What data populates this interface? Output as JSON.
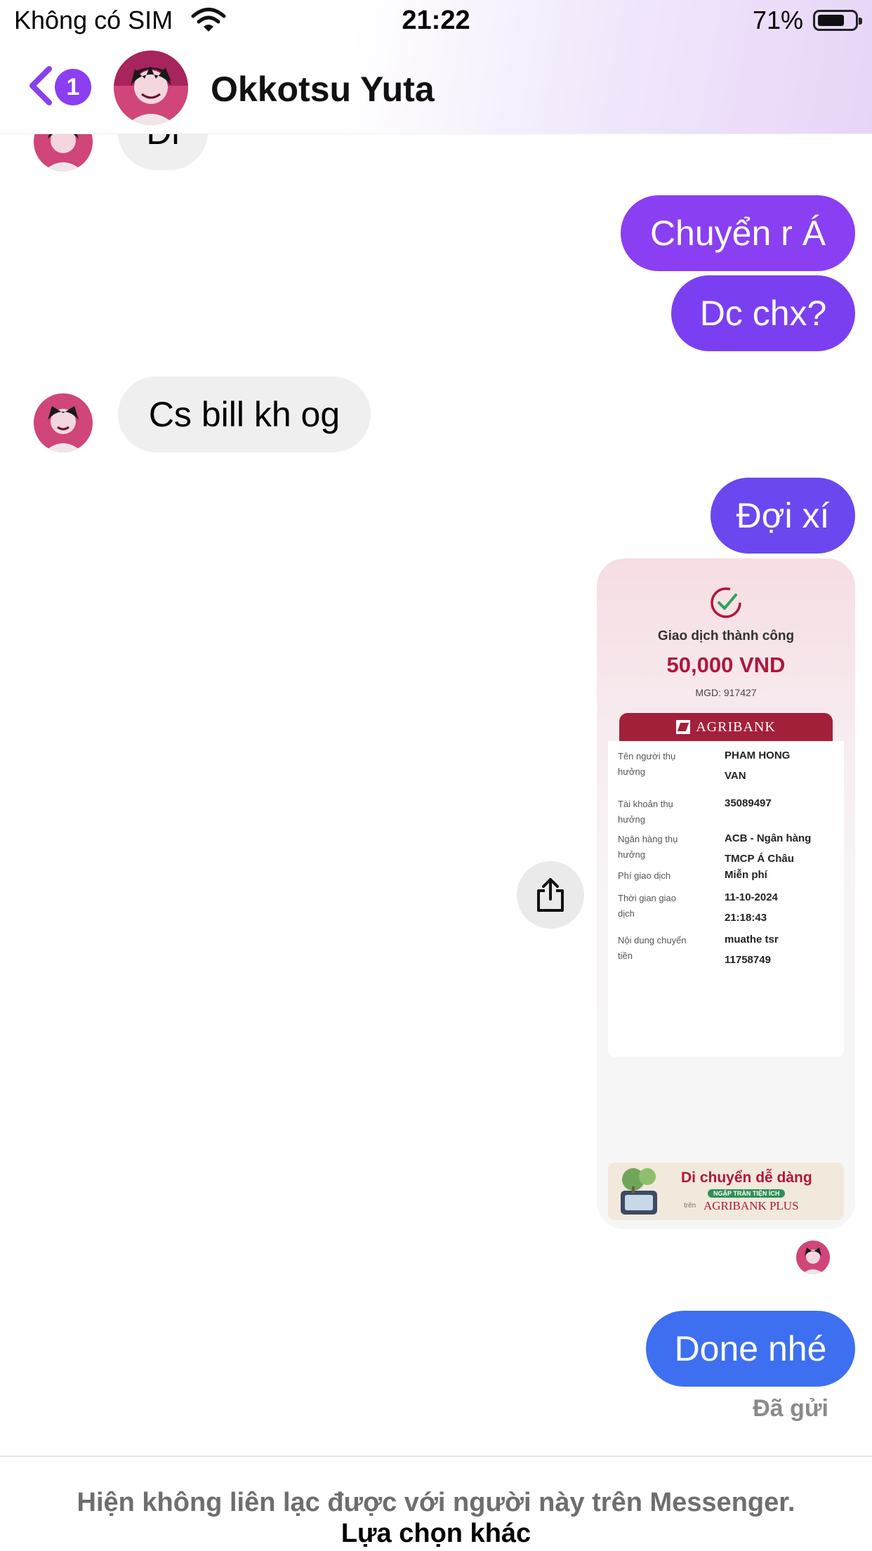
{
  "status_bar": {
    "carrier": "Không có SIM",
    "time": "21:22",
    "battery_percent": "71%",
    "battery_level": 0.71
  },
  "header": {
    "back_badge": "1",
    "contact_name": "Okkotsu Yuta"
  },
  "messages": {
    "partial_incoming": "Đi",
    "out_1": "Chuyển r Á",
    "out_2": "Dc chx?",
    "in_1": "Cs bill kh og",
    "out_3": "Đợi xí",
    "out_4": "Done nhé",
    "sent_status": "Đã gửi"
  },
  "receipt": {
    "status": "Giao dịch thành công",
    "amount": "50,000 VND",
    "mgd": "MGD: 917427",
    "bank_banner": "AGRIBANK",
    "rows": [
      {
        "label_1": "Tên người thụ",
        "label_2": "hưởng",
        "value_1": "PHAM HONG",
        "value_2": "VAN"
      },
      {
        "label_1": "Tài khoản thụ",
        "label_2": "hưởng",
        "value_1": "35089497",
        "value_2": ""
      },
      {
        "label_1": "Ngân hàng thụ",
        "label_2": "hưởng",
        "value_1": "ACB - Ngân hàng",
        "value_2": "TMCP Á Châu"
      },
      {
        "label_1": "Phí giao dịch",
        "label_2": "",
        "value_1": "Miễn phí",
        "value_2": ""
      },
      {
        "label_1": "Thời gian giao",
        "label_2": "dịch",
        "value_1": "11-10-2024",
        "value_2": "21:18:43"
      },
      {
        "label_1": "Nội dung chuyển",
        "label_2": "tiền",
        "value_1": "muathe tsr",
        "value_2": "11758749"
      }
    ],
    "ad_title": "Di chuyển dễ dàng",
    "ad_pill": "NGẬP TRÀN TIỆN ÍCH",
    "ad_small": "trên",
    "ad_brand": "AGRIBANK PLUS"
  },
  "footer": {
    "notice": "Hiện không liên lạc được với người này trên Messenger.",
    "link": "Lựa chọn khác"
  },
  "colors": {
    "purple_bubble": "#7b3ff2",
    "violet_bubble": "#6b47f0",
    "blue_bubble": "#3d6ff0",
    "incoming_bubble": "#efefef",
    "badge": "#8a3ff0",
    "receipt_amount": "#b0173a",
    "agribank_red": "#a3203a"
  }
}
